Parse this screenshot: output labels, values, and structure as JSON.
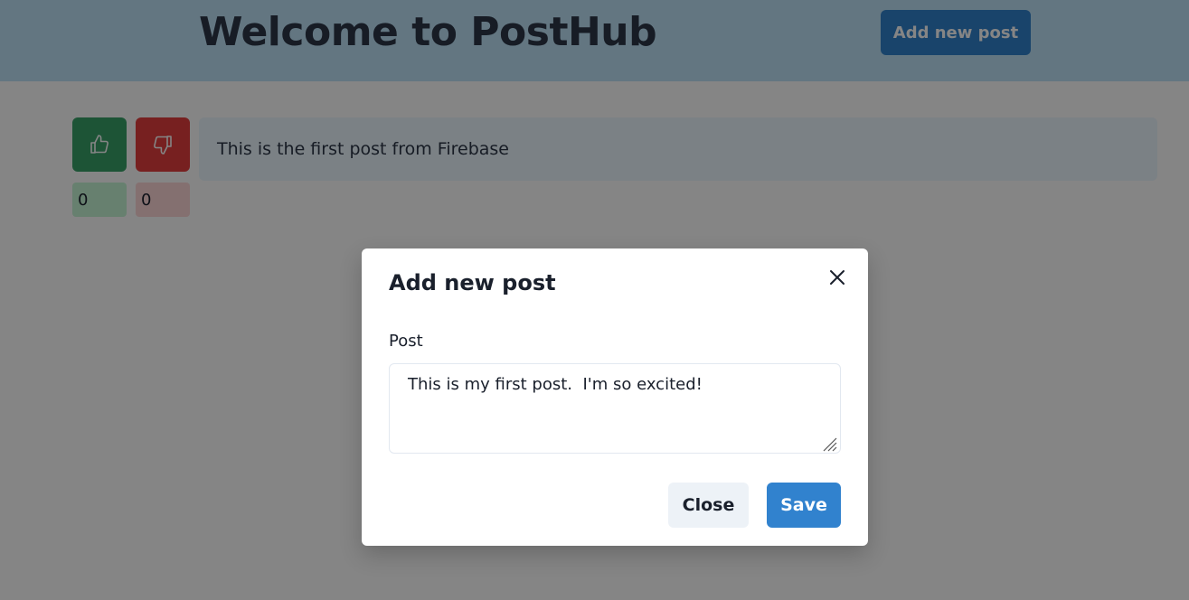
{
  "header": {
    "title": "Welcome to PostHub",
    "add_button_label": "Add new post"
  },
  "posts": [
    {
      "text": "This is the first post from Firebase",
      "upvotes": "0",
      "downvotes": "0",
      "upvote_icon": "thumbs-up-icon",
      "downvote_icon": "thumbs-down-icon"
    }
  ],
  "modal": {
    "title": "Add new post",
    "close_icon": "close-icon",
    "field_label": "Post",
    "textarea_value": "This is my first post.  I'm so excited!",
    "close_button_label": "Close",
    "save_button_label": "Save"
  },
  "colors": {
    "header_bg": "#bee3f8",
    "primary": "#3182ce",
    "upvote": "#38a169",
    "downvote": "#e53e3e",
    "post_bg": "#ebf8ff",
    "overlay": "rgba(0,0,0,0.48)"
  }
}
